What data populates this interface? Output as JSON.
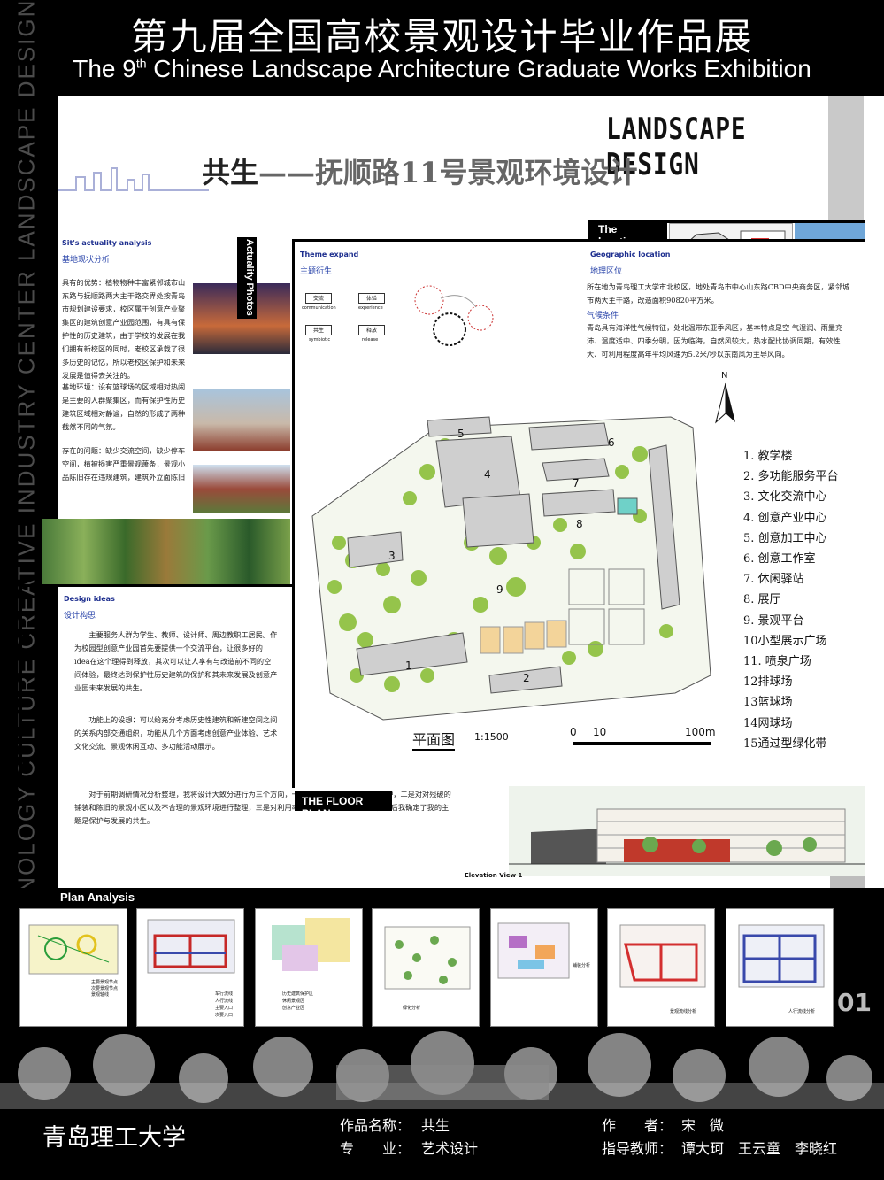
{
  "header": {
    "title_cn": "第九届全国高校景观设计毕业作品展",
    "title_en_pre": "The 9",
    "title_en_sup": "th",
    "title_en_post": " Chinese Landscape Architecture Graduate Works Exhibition"
  },
  "side_text": "SCIENCE AND TECHNOLOGY CULTURE CREATIVE INDUSTRY CENTER LANDSCAPE DESIGN",
  "top_banner": {
    "landscape_design": "LANDSCAPE DESIGN",
    "subject_main": "共生",
    "subject_rest": "——抚顺路11号景观环境设计"
  },
  "actuality": {
    "tab": "Actuality Photos",
    "heading_en": "Sit's actuality analysis",
    "heading_cn": "基地现状分析",
    "p1": "具有的优势：植物物种丰富紧邻城市山东路与抚顺路两大主干路交界处按青岛市规划建设要求，校区属于创意产业聚集区的建筑创意产业园范围，有具有保护性的历史建筑，由于学校的发展在我们拥有新校区的同时，老校区承载了很多历史的记忆，所以老校区保护和未来发展是值得去关注的。",
    "p2": "基地环境：设有篮球场的区域相对热闹是主要的人群聚集区，而有保护性历史建筑区域相对静谧，自然的形成了两种截然不同的气氛。",
    "p3": "存在的问题：缺少交流空间，缺少停车空间，植被损害严重景观萧条，景观小品陈旧存在违规建筑，建筑外立面陈旧"
  },
  "theme": {
    "heading_en": "Theme expand",
    "heading_cn": "主题衍生",
    "boxes": [
      {
        "cn": "交流",
        "en": "communication"
      },
      {
        "cn": "体验",
        "en": "experience"
      },
      {
        "cn": "共生",
        "en": "symbiotic"
      },
      {
        "cn": "释放",
        "en": "release"
      }
    ]
  },
  "location": {
    "tab": "The location",
    "geo_en": "Geographic location",
    "geo_cn": "地理区位",
    "geo_text": "所在地为青岛理工大学市北校区，地处青岛市中心山东路CBD中央商务区，紧邻城市两大主干路，改造面积90820平方米。",
    "climate_cn": "气候条件",
    "climate_text": "青岛具有海洋性气候特征，处北温带东亚季风区，基本特点是空 气湿润、雨量充沛、温度适中、四季分明，因为临海，自然风较大，热水配比协调同期，有效性大、可利用程度高年平均风速为5.2米/秒以东南风为主导风向。"
  },
  "design": {
    "heading_en": "Design ideas",
    "heading_cn": "设计构思",
    "p1": "主要服务人群为学生、教师、设计师、周边教职工居民。作为校园型创意产业园首先要提供一个交流平台，让很多好的idea在这个理得到释放，其次可以让人享有与改造前不同的空间体验，最终达到保护性历史建筑的保护和其未来发展及创意产业园未来发展的共生。",
    "p2": "功能上的设想：可以给充分考虑历史性建筑和新建空间之间的关系内部交通组织，功能从几个方面考虑创意产业体验、艺术文化交流、景观休闲互动、多功能活动展示。",
    "p3": "对于前期调研情况分析整理，我将设计大致分进行为三个方向，一是对保护性历史建筑进行保护，二是对对残破的铺装和陈旧的景观小区以及不合理的景观环境进行整理，三是对利用率低的旧厂房进行loft改造，最后我确定了我的主题是保护与发展的共生。"
  },
  "plan": {
    "north": "N",
    "title": "平面图",
    "scale": "1:1500",
    "scale_0": "0",
    "scale_10": "10",
    "scale_100": "100m",
    "floor_tab": "THE FLOOR PLAN",
    "block_labels": [
      "1",
      "2",
      "3",
      "4",
      "5",
      "6",
      "7",
      "8",
      "9"
    ],
    "legend": [
      "1. 教学楼",
      "2. 多功能服务平台",
      "3. 文化交流中心",
      "4. 创意产业中心",
      "5. 创意加工中心",
      "6. 创意工作室",
      "7. 休闲驿站",
      "8. 展厅",
      "9. 景观平台",
      "10小型展示广场",
      "11. 喷泉广场",
      "12排球场",
      "13篮球场",
      "14网球场",
      "15通过型绿化带"
    ]
  },
  "elevation_label": "Elevation View 1",
  "plan_analysis": {
    "tab": "Plan Analysis",
    "page_no": "01",
    "thumbs": [
      {
        "legend": [
          "主要景观节点",
          "次要景观节点",
          "景观轴线"
        ],
        "color": "#2a9d3a"
      },
      {
        "legend": [
          "车行流线",
          "人行流线",
          "主要入口",
          "次要入口"
        ],
        "color": "#c62828"
      },
      {
        "legend": [
          "历史建筑保护区",
          "休闲景观区",
          "创意产业区"
        ],
        "color": "#7cc4a6"
      },
      {
        "legend": [
          "绿化分析"
        ],
        "color": "#6aa84f"
      },
      {
        "legend": [
          "铺装分析"
        ],
        "color": "#b56fc6"
      },
      {
        "legend": [
          "景观流线分析"
        ],
        "color": "#d32f2f"
      },
      {
        "legend": [
          "人行流线分析"
        ],
        "color": "#3949ab"
      }
    ]
  },
  "footer": {
    "school": "青岛理工大学",
    "work_name_label": "作品名称：",
    "work_name": "共生",
    "major_label": "专　　业：",
    "major": "艺术设计",
    "author_label": "作　　者：",
    "author": "宋　微",
    "advisor_label": "指导教师：",
    "advisor": "谭大珂　王云童　李晓红"
  },
  "colors": {
    "accent_blue": "#1e2f8f",
    "plan_green": "#8bbf3a",
    "building_gray": "#cfcfcf"
  }
}
